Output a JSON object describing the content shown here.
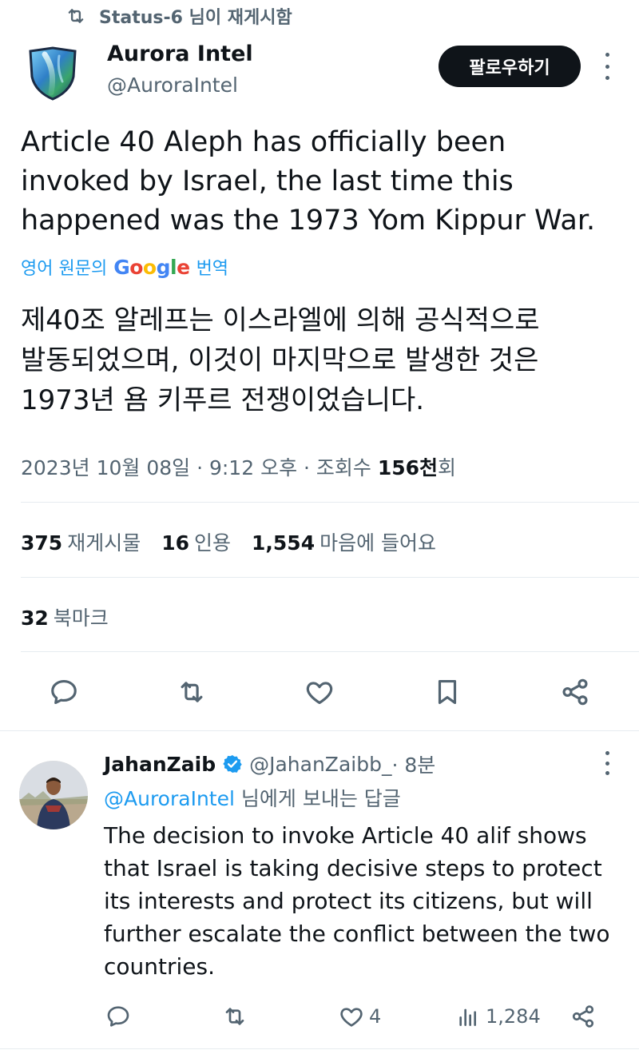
{
  "retweet_header": {
    "text": "Status-6 님이 재게시함"
  },
  "author": {
    "name": "Aurora Intel",
    "handle": "@AuroraIntel",
    "follow_label": "팔로우하기"
  },
  "tweet": {
    "text": "Article 40 Aleph has officially been\ninvoked by Israel, the last time this\nhappened was the 1973 Yom Kippur War.",
    "translate_prefix": "영어 원문의",
    "translate_brand": [
      "G",
      "o",
      "o",
      "g",
      "l",
      "e"
    ],
    "translate_suffix": "번역",
    "translated_text": "제40조 알레프는 이스라엘에 의해 공식적으로\n발동되었으며, 이것이 마지막으로 발생한 것은\n1973년 욤 키푸르 전쟁이었습니다.",
    "meta": {
      "date_time": "2023년 10월 08일 · 9:12 오후 · 조회수 ",
      "views": "156천",
      "views_suffix": "회"
    }
  },
  "stats": {
    "reposts": "375",
    "reposts_label": "재게시물",
    "quotes": "16",
    "quotes_label": "인용",
    "likes": "1,554",
    "likes_label": "마음에 들어요",
    "bookmarks": "32",
    "bookmarks_label": "북마크"
  },
  "action_icons": [
    "reply-icon",
    "repost-icon",
    "like-icon",
    "bookmark-icon",
    "share-icon"
  ],
  "reply": {
    "name": "JahanZaib",
    "handle": "@JahanZaibb_",
    "time": " · 8분",
    "reply_to_handle": "@AuroraIntel",
    "reply_to_suffix": " 님에게 보내는 답글",
    "text": "The decision to invoke Article 40 alif shows\nthat Israel is taking decisive steps to protect\nits interests and protect its citizens, but will\nfurther escalate the conflict between the two\ncountries.",
    "likes": "4",
    "views": "1,284"
  },
  "colors": {
    "text": "#0f1419",
    "muted": "#536471",
    "accent": "#1d9bf0",
    "follow_bg": "#0f1419",
    "divider": "#e6ecf0"
  }
}
